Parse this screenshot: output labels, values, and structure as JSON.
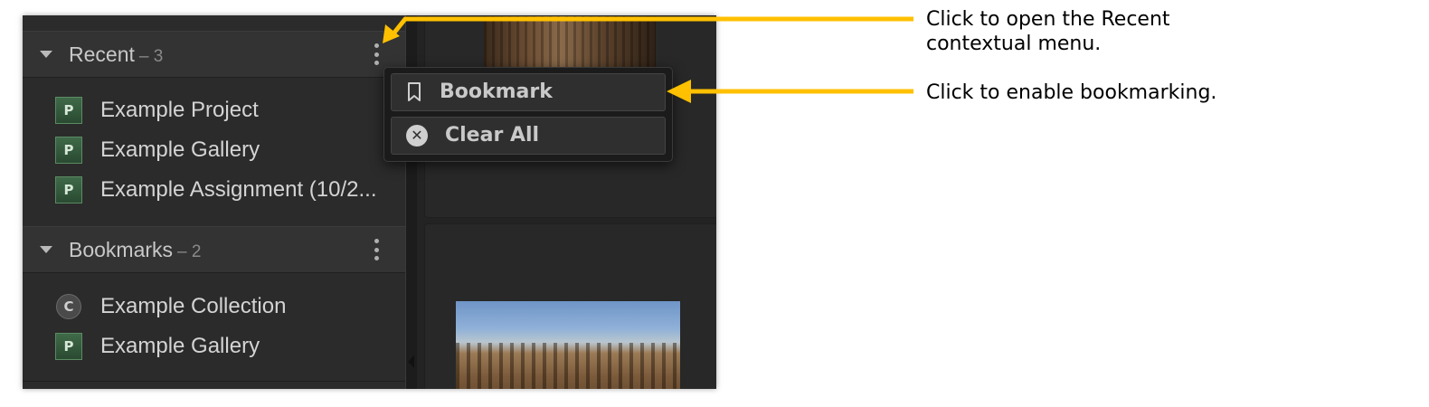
{
  "sidebar": {
    "recent": {
      "title": "Recent",
      "count": "– 3",
      "items": [
        {
          "badge": "P",
          "label": "Example Project"
        },
        {
          "badge": "P",
          "label": "Example Gallery"
        },
        {
          "badge": "P",
          "label": "Example Assignment (10/2..."
        }
      ]
    },
    "bookmarks": {
      "title": "Bookmarks",
      "count": "– 2",
      "items": [
        {
          "badge": "C",
          "label": "Example Collection"
        },
        {
          "badge": "P",
          "label": "Example Gallery"
        }
      ]
    }
  },
  "menu": {
    "items": [
      {
        "label": "Bookmark",
        "icon": "bookmark-icon"
      },
      {
        "label": "Clear All",
        "icon": "clear-circle-x-icon",
        "glyph": "✕"
      }
    ]
  },
  "annotations": {
    "open_menu_line1": "Click to open the Recent",
    "open_menu_line2": "contextual menu.",
    "enable_bookmarking": "Click to enable bookmarking.",
    "arrow_color": "#FFC000"
  }
}
